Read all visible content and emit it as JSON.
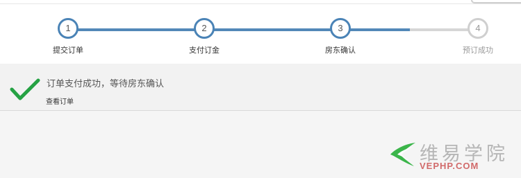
{
  "steps": [
    {
      "number": "1",
      "label": "提交订单",
      "state": "done"
    },
    {
      "number": "2",
      "label": "支付订金",
      "state": "done"
    },
    {
      "number": "3",
      "label": "房东确认",
      "state": "current"
    },
    {
      "number": "4",
      "label": "预订成功",
      "state": "pending"
    }
  ],
  "result": {
    "icon": "check-icon",
    "title": "订单支付成功，等待房东确认",
    "view_order_link": "查看订单"
  },
  "watermark": {
    "text": "维易学院",
    "subtext": "VEPHP.COM",
    "logo_color": "#3bb54a",
    "subtext_color": "#d16a6a"
  },
  "colors": {
    "progress_done": "#5288b8",
    "progress_todo": "#d6d6d6",
    "success_check": "#25a244"
  }
}
